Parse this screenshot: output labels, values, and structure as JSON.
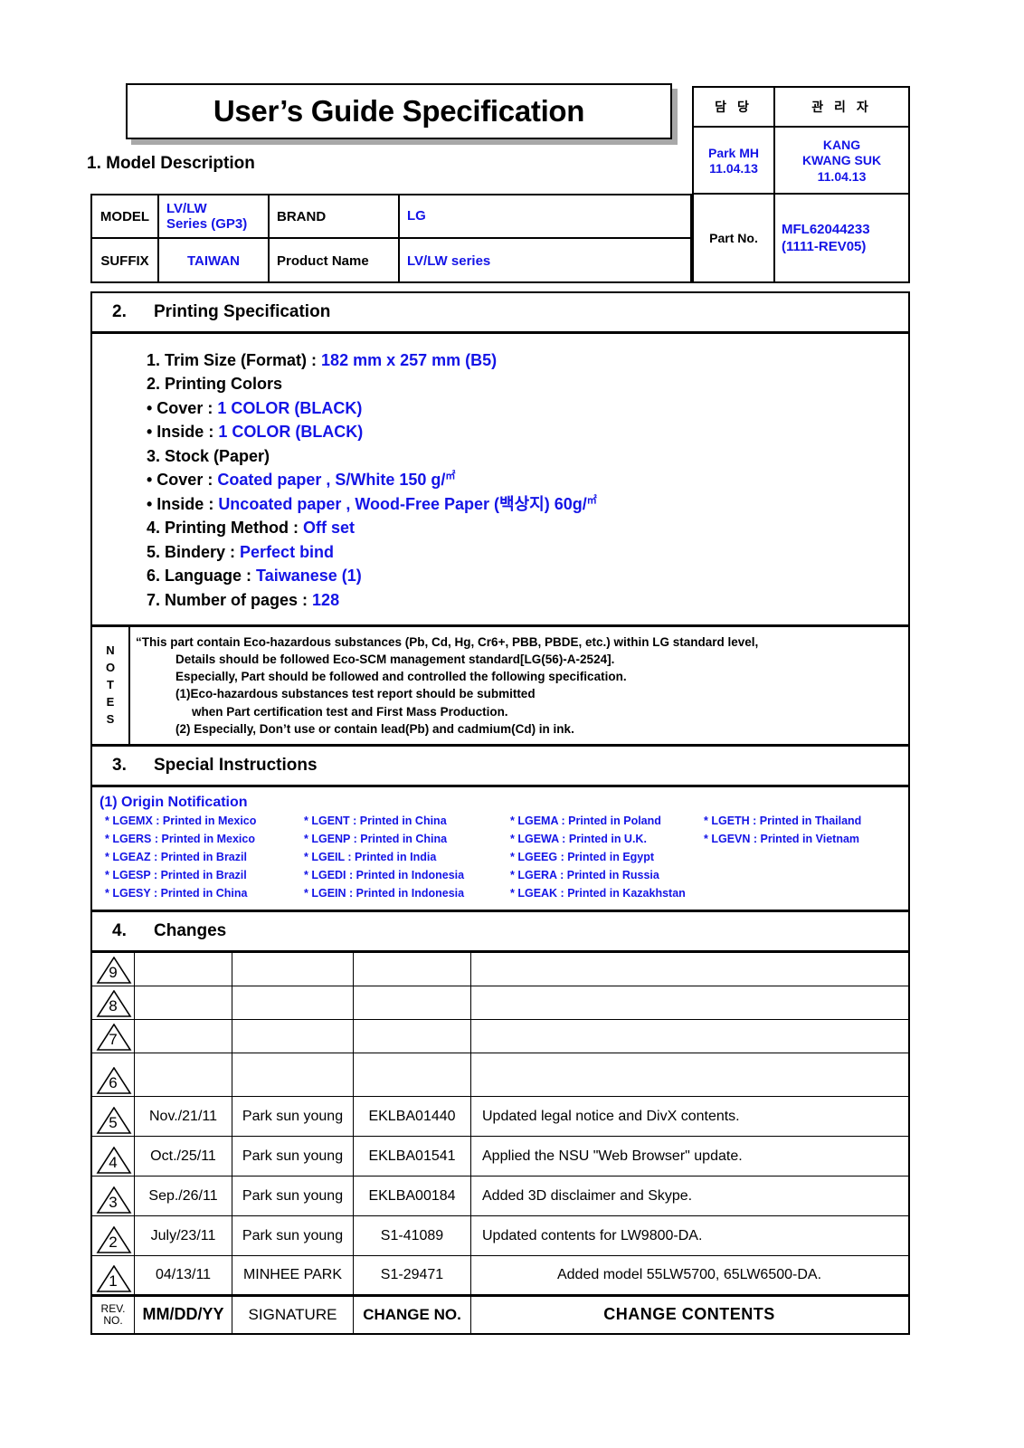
{
  "title": "User’s Guide Specification",
  "colors": {
    "accent_blue": "#1414e6",
    "ink": "#000000"
  },
  "approval": {
    "col1_header": "담 당",
    "col2_header": "관 리 자",
    "col1_name": "Park MH",
    "col1_date": "11.04.13",
    "col2_name_line1": "KANG",
    "col2_name_line2": "KWANG SUK",
    "col2_date": "11.04.13"
  },
  "part": {
    "label": "Part No.",
    "number": "MFL62044233",
    "revision": "(1111-REV05)"
  },
  "section1": {
    "heading": "1. Model Description",
    "model_label": "MODEL",
    "model_value_line1": "LV/LW",
    "model_value_line2": "Series (GP3)",
    "brand_label": "BRAND",
    "brand_value": "LG",
    "suffix_label": "SUFFIX",
    "suffix_value": "TAIWAN",
    "product_name_label": "Product Name",
    "product_name_value": "LV/LW series"
  },
  "section2": {
    "number": "2.",
    "heading": "Printing Specification",
    "items": [
      {
        "label": "1. Trim Size (Format) : ",
        "value": "182 mm x 257 mm (B5)"
      },
      {
        "label": "2. Printing Colors",
        "value": ""
      },
      {
        "label": "• Cover : ",
        "value": "1 COLOR (BLACK)"
      },
      {
        "label": "• Inside : ",
        "value": "1 COLOR (BLACK)"
      },
      {
        "label": "3. Stock (Paper)",
        "value": ""
      },
      {
        "label": "• Cover : ",
        "value": "Coated paper , S/White 150 g/㎡"
      },
      {
        "label": "• Inside : ",
        "value": "Uncoated paper , Wood-Free Paper (백상지) 60g/㎡"
      },
      {
        "label": "4. Printing Method : ",
        "value": "Off set"
      },
      {
        "label": "5. Bindery  : ",
        "value": "Perfect bind"
      },
      {
        "label": "6. Language : ",
        "value": "Taiwanese (1)"
      },
      {
        "label": "7. Number of pages : ",
        "value": "128"
      }
    ]
  },
  "notes": {
    "label_letters": [
      "N",
      "O",
      "T",
      "E",
      "S"
    ],
    "lines": [
      "“This part contain Eco-hazardous substances (Pb, Cd, Hg, Cr6+, PBB, PBDE, etc.) within LG standard level,",
      "Details should be followed Eco-SCM management standard[LG(56)-A-2524].",
      "Especially, Part should be followed and controlled the following specification.",
      "(1)Eco-hazardous substances test report should be submitted",
      "when  Part certification test and First Mass Production.",
      "(2) Especially, Don’t use or contain lead(Pb) and cadmium(Cd) in ink."
    ]
  },
  "section3": {
    "number": "3.",
    "heading": "Special Instructions",
    "origin_title": "(1) Origin Notification",
    "origin_rows": [
      [
        "* LGEMX : Printed in Mexico",
        "* LGENT : Printed in China",
        "* LGEMA : Printed in Poland",
        "* LGETH : Printed in Thailand"
      ],
      [
        "* LGERS : Printed in Mexico",
        "* LGENP : Printed in China",
        "* LGEWA : Printed in U.K.",
        "* LGEVN : Printed in Vietnam"
      ],
      [
        "* LGEAZ : Printed in Brazil",
        "* LGEIL : Printed in India",
        "* LGEEG : Printed in Egypt",
        ""
      ],
      [
        "* LGESP : Printed in Brazil",
        "* LGEDI : Printed in Indonesia",
        "* LGERA : Printed in Russia",
        ""
      ],
      [
        "* LGESY : Printed in China",
        "* LGEIN : Printed in Indonesia",
        "* LGEAK : Printed in Kazakhstan",
        ""
      ]
    ]
  },
  "section4": {
    "number": "4.",
    "heading": "Changes",
    "rows": [
      {
        "rev": "9",
        "date": "",
        "signature": "",
        "change_no": "",
        "contents": ""
      },
      {
        "rev": "8",
        "date": "",
        "signature": "",
        "change_no": "",
        "contents": ""
      },
      {
        "rev": "7",
        "date": "",
        "signature": "",
        "change_no": "",
        "contents": ""
      },
      {
        "rev": "6",
        "date": "",
        "signature": "",
        "change_no": "",
        "contents": ""
      },
      {
        "rev": "5",
        "date": "Nov./21/11",
        "signature": "Park sun young",
        "change_no": "EKLBA01440",
        "contents": "Updated legal notice and DivX contents."
      },
      {
        "rev": "4",
        "date": "Oct./25/11",
        "signature": "Park sun young",
        "change_no": "EKLBA01541",
        "contents": "Applied the NSU \"Web Browser\" update."
      },
      {
        "rev": "3",
        "date": "Sep./26/11",
        "signature": "Park sun young",
        "change_no": "EKLBA00184",
        "contents": "Added 3D disclaimer and Skype."
      },
      {
        "rev": "2",
        "date": "July/23/11",
        "signature": "Park sun young",
        "change_no": "S1-41089",
        "contents": "Updated contents for LW9800-DA."
      },
      {
        "rev": "1",
        "date": "04/13/11",
        "signature": "MINHEE PARK",
        "change_no": "S1-29471",
        "contents": "Added model 55LW5700, 65LW6500-DA."
      }
    ],
    "footer": {
      "rev_label_line1": "REV.",
      "rev_label_line2": "NO.",
      "date_label": "MM/DD/YY",
      "signature_label": "SIGNATURE",
      "change_no_label": "CHANGE NO.",
      "contents_label": "CHANGE   CONTENTS"
    }
  }
}
